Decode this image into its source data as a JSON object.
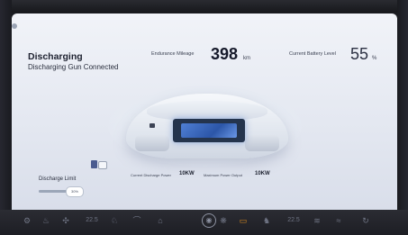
{
  "status": {
    "title": "Discharging",
    "subtitle": "Discharging Gun Connected"
  },
  "endurance": {
    "label": "Endurance Mileage",
    "value": "398",
    "unit": "km"
  },
  "battery": {
    "label": "Current Battery Level",
    "value": "55",
    "unit": "%"
  },
  "discharge_limit": {
    "label": "Discharge Limit",
    "value_text": "30%",
    "value": 0.75
  },
  "power": {
    "current_label": "Current Discharge Power",
    "current_value": "10KW",
    "max_label": "Maximum Power Output",
    "max_value": "10KW"
  },
  "dock": {
    "items": [
      {
        "icon": "gear-icon",
        "glyph": "⚙"
      },
      {
        "icon": "seat-heat-icon",
        "glyph": "♨"
      },
      {
        "icon": "fan-icon",
        "glyph": "✣"
      },
      {
        "icon": "temp-left",
        "text": "22.5"
      },
      {
        "icon": "seat-icon",
        "glyph": "♘"
      },
      {
        "icon": "wiper-icon",
        "glyph": "⌒"
      },
      {
        "icon": "car-icon",
        "glyph": "⌂"
      },
      {
        "icon": "home-icon",
        "glyph": "◉"
      },
      {
        "icon": "ac-icon",
        "glyph": "❋"
      },
      {
        "icon": "battery-icon",
        "glyph": "▭"
      },
      {
        "icon": "seat-right-icon",
        "glyph": "♞"
      },
      {
        "icon": "temp-right",
        "text": "22.5"
      },
      {
        "icon": "rear-defrost-icon",
        "glyph": "≋"
      },
      {
        "icon": "front-defrost-icon",
        "glyph": "≈"
      },
      {
        "icon": "recirculation-icon",
        "glyph": "↻"
      }
    ],
    "accent_color": "#d98a1e"
  }
}
